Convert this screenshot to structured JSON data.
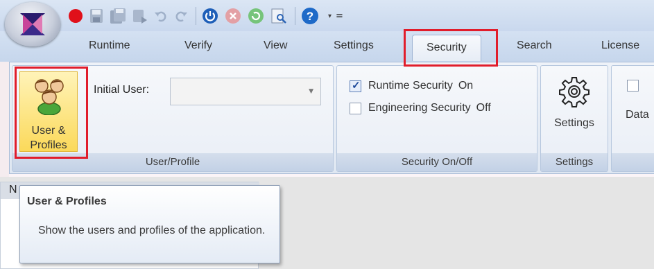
{
  "quick_access": {
    "icons": [
      "record-icon",
      "save-icon",
      "save-all-icon",
      "publish-icon",
      "undo-icon",
      "redo-icon",
      "power-icon",
      "stop-icon",
      "refresh-icon",
      "find-icon",
      "help-icon"
    ],
    "help_dropdown": "▾",
    "customize": "="
  },
  "tabs": [
    {
      "label": "Runtime"
    },
    {
      "label": "Verify"
    },
    {
      "label": "View"
    },
    {
      "label": "Settings"
    },
    {
      "label": "Security",
      "active": true
    },
    {
      "label": "Search"
    },
    {
      "label": "License"
    }
  ],
  "ribbon": {
    "user_profile_group": {
      "button_label_line1": "User &",
      "button_label_line2": "Profiles",
      "initial_user_label": "Initial User:",
      "initial_user_value": "",
      "group_label": "User/Profile"
    },
    "security_group": {
      "runtime_security_label": "Runtime Security",
      "runtime_security_state": "On",
      "runtime_security_checked": true,
      "engineering_security_label": "Engineering Security",
      "engineering_security_state": "Off",
      "engineering_security_checked": false,
      "group_label": "Security On/Off"
    },
    "settings_group": {
      "button_label": "Settings",
      "group_label": "Settings"
    },
    "data_group": {
      "checkbox_label": "Data",
      "checked": false
    }
  },
  "panel": {
    "header_letter": "N"
  },
  "tooltip": {
    "title": "User & Profiles",
    "body": "Show the users and profiles of the application."
  },
  "colors": {
    "highlight": "#e11d2b",
    "ribbon_bg": "#e9eef6",
    "button_hover": "#fbd95a"
  }
}
